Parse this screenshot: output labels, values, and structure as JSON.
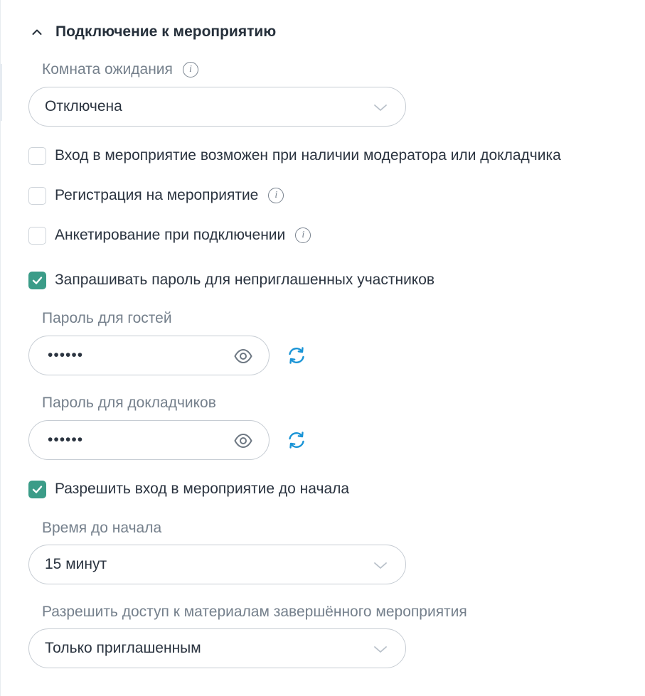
{
  "section": {
    "title": "Подключение к мероприятию",
    "icon": "chevron-up-icon"
  },
  "waiting_room": {
    "label": "Комната ожидания",
    "value": "Отключена"
  },
  "options": {
    "moderator_required": {
      "label": "Вход в мероприятие возможен при наличии модератора или докладчика",
      "checked": false
    },
    "registration": {
      "label": "Регистрация на мероприятие",
      "checked": false
    },
    "survey": {
      "label": "Анкетирование при подключении",
      "checked": false
    },
    "ask_password": {
      "label": "Запрашивать пароль для неприглашенных участников",
      "checked": true
    }
  },
  "guest_password": {
    "label": "Пароль для гостей",
    "value": "••••••"
  },
  "speaker_password": {
    "label": "Пароль для докладчиков",
    "value": "••••••"
  },
  "early_entry": {
    "label": "Разрешить вход в мероприятие до начала",
    "checked": true
  },
  "time_before": {
    "label": "Время до начала",
    "value": "15 минут"
  },
  "materials_access": {
    "label": "Разрешить доступ к материалам завершённого мероприятия",
    "value": "Только приглашенным"
  },
  "colors": {
    "accent": "#3b9c88",
    "refresh_icon": "#1a94d6",
    "label": "#75808c",
    "border": "#c6ccd3"
  }
}
